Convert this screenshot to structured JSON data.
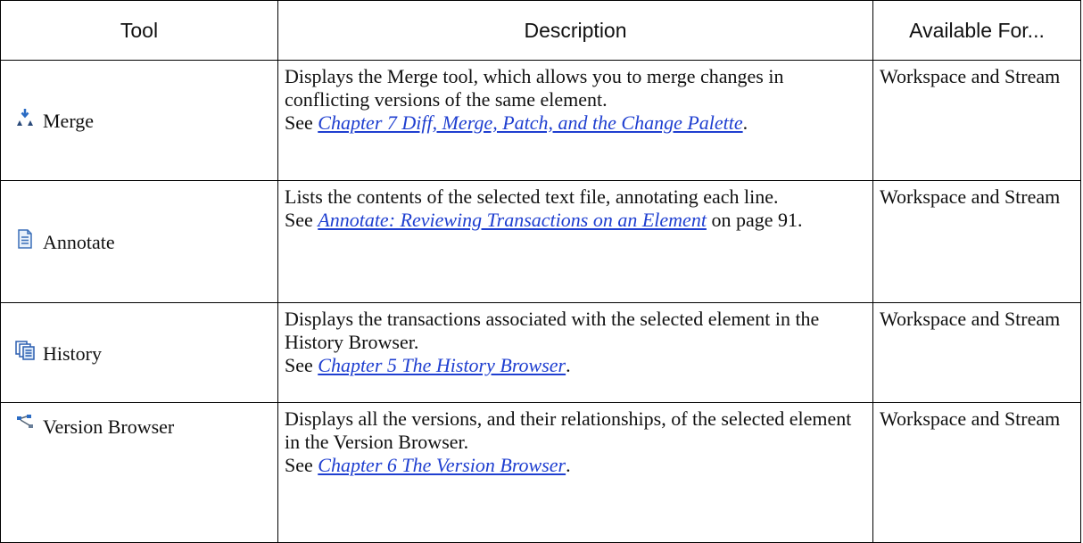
{
  "headers": {
    "tool": "Tool",
    "description": "Description",
    "available_for": "Available For..."
  },
  "rows": [
    {
      "icon": "merge-icon",
      "tool": "Merge",
      "desc_line": "Displays the Merge tool, which allows you to merge changes in conflicting versions of the same element.",
      "see_prefix": "See ",
      "link": "Chapter 7 Diff, Merge, Patch, and  the Change Palette",
      "suffix": ".",
      "available": "Workspace and Stream"
    },
    {
      "icon": "document-icon",
      "tool": "Annotate",
      "desc_line": "Lists the contents of the selected text file, annotating each line.",
      "see_prefix": "See ",
      "link": "Annotate: Reviewing Transactions on an Element",
      "suffix": " on page 91.",
      "available": "Workspace and Stream"
    },
    {
      "icon": "history-icon",
      "tool": "History",
      "desc_line": "Displays the transactions associated with the selected element in the History Browser.",
      "see_prefix": "See ",
      "link": "Chapter 5 The History Browser",
      "suffix": ".",
      "available": "Workspace and Stream"
    },
    {
      "icon": "version-tree-icon",
      "tool": "Version Browser",
      "desc_line": "Displays all the versions, and their relationships, of the selected element in the Version Browser.",
      "see_prefix": "See ",
      "link": "Chapter 6 The Version Browser",
      "suffix": ".",
      "available": "Workspace and Stream"
    }
  ]
}
